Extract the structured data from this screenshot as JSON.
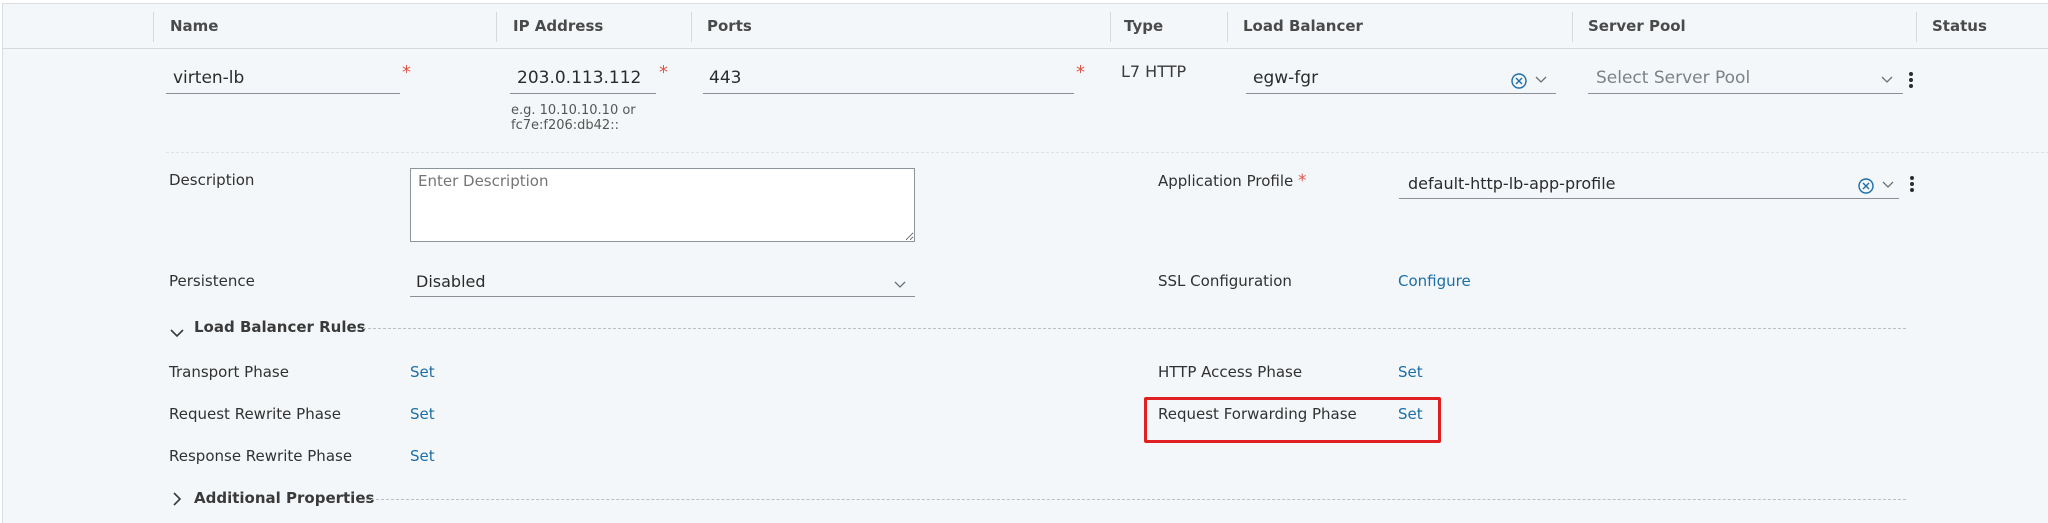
{
  "table": {
    "headers": {
      "name": "Name",
      "ip": "IP Address",
      "ports": "Ports",
      "type": "Type",
      "load_balancer": "Load Balancer",
      "server_pool": "Server Pool",
      "status": "Status"
    },
    "row": {
      "name": "virten-lb",
      "ip": "203.0.113.112",
      "ip_hint_line1": "e.g. 10.10.10.10 or",
      "ip_hint_line2": "fc7e:f206:db42::",
      "ports": "443",
      "type": "L7 HTTP",
      "load_balancer": "egw-fgr",
      "server_pool_placeholder": "Select Server Pool"
    }
  },
  "details": {
    "description_label": "Description",
    "description_placeholder": "Enter Description",
    "app_profile_label": "Application Profile",
    "app_profile_value": "default-http-lb-app-profile",
    "persistence_label": "Persistence",
    "persistence_value": "Disabled",
    "ssl_label": "SSL Configuration",
    "ssl_link": "Configure"
  },
  "rules": {
    "section_title": "Load Balancer Rules",
    "transport_label": "Transport Phase",
    "transport_link": "Set",
    "http_access_label": "HTTP Access Phase",
    "http_access_link": "Set",
    "request_rewrite_label": "Request Rewrite Phase",
    "request_rewrite_link": "Set",
    "request_forwarding_label": "Request Forwarding Phase",
    "request_forwarding_link": "Set",
    "response_rewrite_label": "Response Rewrite Phase",
    "response_rewrite_link": "Set"
  },
  "additional": {
    "section_title": "Additional Properties"
  },
  "required_marker": "*",
  "colors": {
    "link": "#1b6ea8",
    "required": "#e0564b",
    "highlight": "#e02020",
    "background": "#f4f7f9"
  }
}
